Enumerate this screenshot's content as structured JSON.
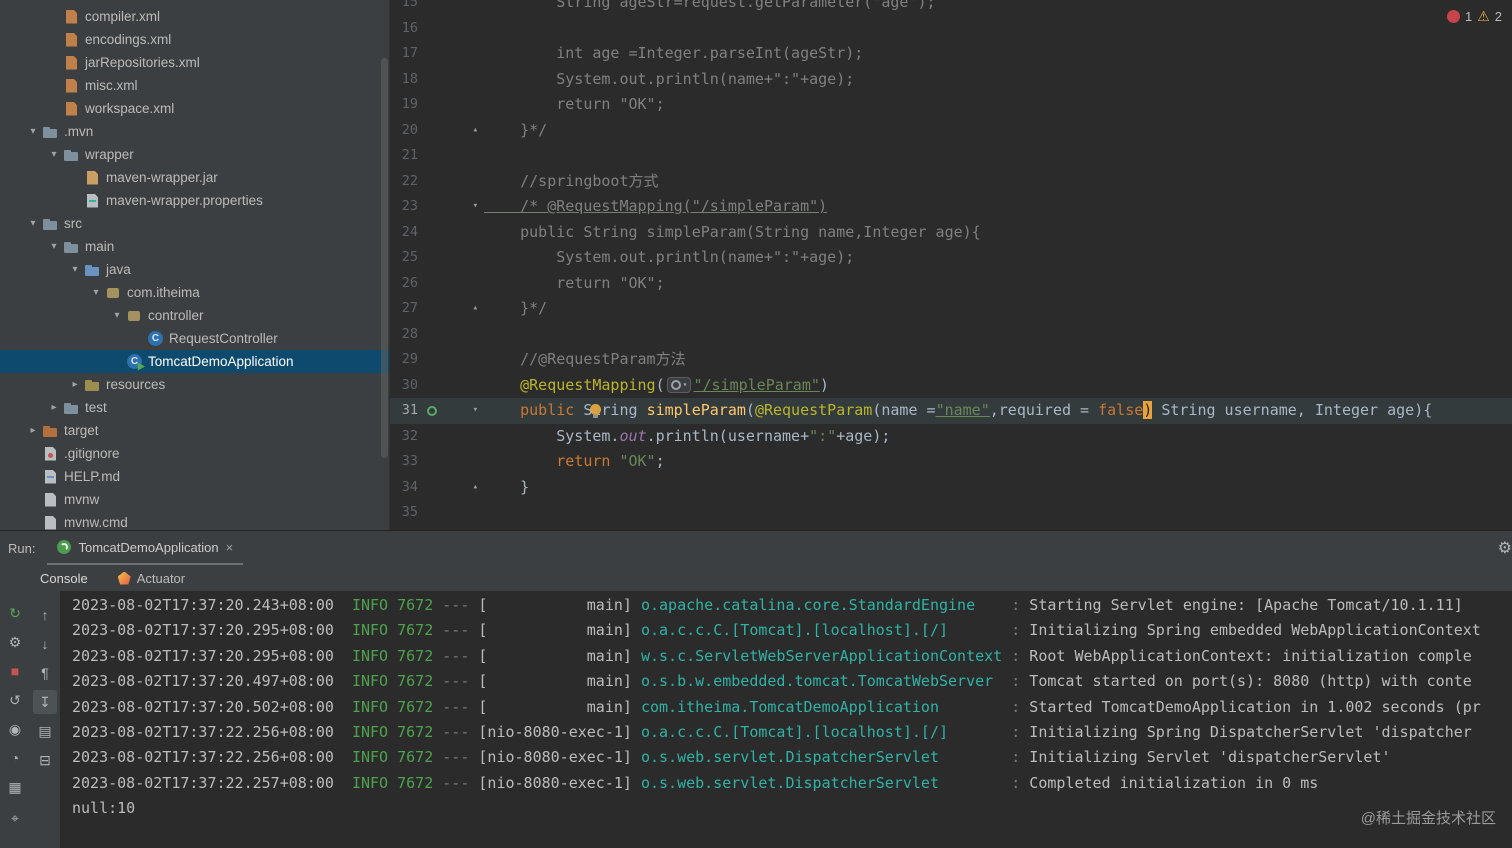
{
  "window": {
    "watermark": "@稀土掘金技术社区"
  },
  "icons": {
    "chevron_expanded": "▾",
    "chevron_collapsed": "▸",
    "fold_down": "▾",
    "fold_up": "▴",
    "warning": "⚠",
    "gear": "⚙"
  },
  "inspections": {
    "errors": "1",
    "warnings": "2"
  },
  "project_tree": {
    "items": [
      {
        "label": "compiler.xml",
        "level": 1,
        "icon": "xml"
      },
      {
        "label": "encodings.xml",
        "level": 1,
        "icon": "xml"
      },
      {
        "label": "jarRepositories.xml",
        "level": 1,
        "icon": "xml"
      },
      {
        "label": "misc.xml",
        "level": 1,
        "icon": "xml"
      },
      {
        "label": "workspace.xml",
        "level": 1,
        "icon": "xml"
      },
      {
        "label": ".mvn",
        "level": 0,
        "icon": "folder",
        "state": "expanded"
      },
      {
        "label": "wrapper",
        "level": 1,
        "icon": "folder",
        "state": "expanded"
      },
      {
        "label": "maven-wrapper.jar",
        "level": 2,
        "icon": "jar"
      },
      {
        "label": "maven-wrapper.properties",
        "level": 2,
        "icon": "props"
      },
      {
        "label": "src",
        "level": 0,
        "icon": "folder",
        "state": "expanded"
      },
      {
        "label": "main",
        "level": 1,
        "icon": "folder",
        "state": "expanded"
      },
      {
        "label": "java",
        "level": 2,
        "icon": "folder-src",
        "state": "expanded"
      },
      {
        "label": "com.itheima",
        "level": 3,
        "icon": "package",
        "state": "expanded"
      },
      {
        "label": "controller",
        "level": 4,
        "icon": "package",
        "state": "expanded"
      },
      {
        "label": "RequestController",
        "level": 5,
        "icon": "class"
      },
      {
        "label": "TomcatDemoApplication",
        "level": 4,
        "icon": "class-run",
        "selected": true
      },
      {
        "label": "resources",
        "level": 2,
        "icon": "folder-res",
        "state": "collapsed"
      },
      {
        "label": "test",
        "level": 1,
        "icon": "folder",
        "state": "collapsed"
      },
      {
        "label": "target",
        "level": 0,
        "icon": "folder-exc",
        "state": "collapsed"
      },
      {
        "label": ".gitignore",
        "level": 0,
        "icon": "git"
      },
      {
        "label": "HELP.md",
        "level": 0,
        "icon": "md"
      },
      {
        "label": "mvnw",
        "level": 0,
        "icon": "filegen"
      },
      {
        "label": "mvnw.cmd",
        "level": 0,
        "icon": "filegen"
      }
    ]
  },
  "editor": {
    "lines": [
      {
        "n": 15,
        "tokens": [
          [
            "c",
            "        String ageStr=request.getParameter(\"age\");"
          ]
        ]
      },
      {
        "n": 16,
        "tokens": []
      },
      {
        "n": 17,
        "tokens": [
          [
            "c",
            "        int age =Integer.parseInt(ageStr);"
          ]
        ]
      },
      {
        "n": 18,
        "tokens": [
          [
            "c",
            "        System.out.println(name+\":\"+age);"
          ]
        ]
      },
      {
        "n": 19,
        "tokens": [
          [
            "c",
            "        return \"OK\";"
          ]
        ]
      },
      {
        "n": 20,
        "fold": "up",
        "tokens": [
          [
            "c",
            "    }*/"
          ]
        ]
      },
      {
        "n": 21,
        "tokens": []
      },
      {
        "n": 22,
        "tokens": [
          [
            "c",
            "    //springboot方式"
          ]
        ]
      },
      {
        "n": 23,
        "fold": "down",
        "tokens": [
          [
            "cu",
            "    /* @RequestMapping(\"/simpleParam\")"
          ]
        ]
      },
      {
        "n": 24,
        "tokens": [
          [
            "c",
            "    public String simpleParam(String name,Integer age){"
          ]
        ]
      },
      {
        "n": 25,
        "tokens": [
          [
            "c",
            "        System.out.println(name+\":\"+age);"
          ]
        ]
      },
      {
        "n": 26,
        "tokens": [
          [
            "c",
            "        return \"OK\";"
          ]
        ]
      },
      {
        "n": 27,
        "fold": "up",
        "tokens": [
          [
            "c",
            "    }*/"
          ]
        ]
      },
      {
        "n": 28,
        "tokens": []
      },
      {
        "n": 29,
        "tokens": [
          [
            "c",
            "    //@RequestParam方法"
          ]
        ]
      },
      {
        "n": 30,
        "tokens": [
          [
            "d",
            "    "
          ],
          [
            "a",
            "@RequestMapping"
          ],
          [
            "d",
            "("
          ],
          [
            "inlay",
            ""
          ],
          [
            "slink",
            "\"/simpleParam\""
          ],
          [
            "d",
            ")"
          ]
        ]
      },
      {
        "n": 31,
        "current": true,
        "bean": true,
        "bulb": true,
        "fold": "down",
        "tokens": [
          [
            "d",
            "    "
          ],
          [
            "k",
            "public"
          ],
          [
            "d",
            " String "
          ],
          [
            "m",
            "simpleParam"
          ],
          [
            "d",
            "("
          ],
          [
            "a",
            "@RequestParam"
          ],
          [
            "d",
            "(name ="
          ],
          [
            "slink",
            "\"name\""
          ],
          [
            "d",
            ",required = "
          ],
          [
            "k",
            "false"
          ],
          [
            "caret",
            ")"
          ],
          [
            "d",
            " String username, Integer age){"
          ]
        ]
      },
      {
        "n": 32,
        "tokens": [
          [
            "d",
            "        System."
          ],
          [
            "f",
            "out"
          ],
          [
            "d",
            ".println(username+"
          ],
          [
            "s",
            "\":\""
          ],
          [
            "d",
            "+age);"
          ]
        ]
      },
      {
        "n": 33,
        "tokens": [
          [
            "d",
            "        "
          ],
          [
            "k",
            "return"
          ],
          [
            "d",
            " "
          ],
          [
            "s",
            "\"OK\""
          ],
          [
            "d",
            ";"
          ]
        ]
      },
      {
        "n": 34,
        "fold": "up",
        "tokens": [
          [
            "d",
            "    }"
          ]
        ]
      },
      {
        "n": 35,
        "tokens": []
      }
    ]
  },
  "run_panel": {
    "run_label": "Run:",
    "tab": {
      "title": "TomcatDemoApplication",
      "close": "×"
    },
    "tabs": [
      {
        "label": "Console",
        "selected": true
      },
      {
        "label": "Actuator"
      }
    ],
    "toolbar_main": [
      {
        "name": "rerun-button",
        "glyph": "↻",
        "color": "#5aa45e"
      },
      {
        "name": "settings-button",
        "glyph": "⚙"
      },
      {
        "name": "stop-button",
        "glyph": "■",
        "color": "#c75450"
      },
      {
        "name": "rerun-failed-button",
        "glyph": "↺"
      },
      {
        "name": "thread-dump-button",
        "glyph": "◉"
      },
      {
        "name": "profiler-button",
        "glyph": "◔"
      },
      {
        "name": "layout-button",
        "glyph": "▦"
      },
      {
        "name": "pin-button",
        "glyph": "⌖",
        "bottom": true
      }
    ],
    "toolbar_console": [
      {
        "name": "prev-occurrence-button",
        "glyph": "↑"
      },
      {
        "name": "next-occurrence-button",
        "glyph": "↓"
      },
      {
        "name": "soft-wrap-button",
        "glyph": "¶"
      },
      {
        "name": "scroll-to-end-button",
        "glyph": "↧",
        "active": true
      },
      {
        "name": "print-button",
        "glyph": "▤"
      },
      {
        "name": "clear-console-button",
        "glyph": "⊟"
      }
    ],
    "console": {
      "lines": [
        {
          "ts": "2023-08-02T17:37:20.243+08:00",
          "level": "INFO",
          "pid": "7672",
          "thread": "main",
          "logger": "o.apache.catalina.core.StandardEngine",
          "msg": "Starting Servlet engine: [Apache Tomcat/10.1.11]"
        },
        {
          "ts": "2023-08-02T17:37:20.295+08:00",
          "level": "INFO",
          "pid": "7672",
          "thread": "main",
          "logger": "o.a.c.c.C.[Tomcat].[localhost].[/]",
          "msg": "Initializing Spring embedded WebApplicationContext"
        },
        {
          "ts": "2023-08-02T17:37:20.295+08:00",
          "level": "INFO",
          "pid": "7672",
          "thread": "main",
          "logger": "w.s.c.ServletWebServerApplicationContext",
          "msg": "Root WebApplicationContext: initialization comple"
        },
        {
          "ts": "2023-08-02T17:37:20.497+08:00",
          "level": "INFO",
          "pid": "7672",
          "thread": "main",
          "logger": "o.s.b.w.embedded.tomcat.TomcatWebServer",
          "msg": "Tomcat started on port(s): 8080 (http) with conte"
        },
        {
          "ts": "2023-08-02T17:37:20.502+08:00",
          "level": "INFO",
          "pid": "7672",
          "thread": "main",
          "logger": "com.itheima.TomcatDemoApplication",
          "msg": "Started TomcatDemoApplication in 1.002 seconds (pr"
        },
        {
          "ts": "2023-08-02T17:37:22.256+08:00",
          "level": "INFO",
          "pid": "7672",
          "thread": "nio-8080-exec-1",
          "logger": "o.a.c.c.C.[Tomcat].[localhost].[/]",
          "msg": "Initializing Spring DispatcherServlet 'dispatcher"
        },
        {
          "ts": "2023-08-02T17:37:22.256+08:00",
          "level": "INFO",
          "pid": "7672",
          "thread": "nio-8080-exec-1",
          "logger": "o.s.web.servlet.DispatcherServlet",
          "msg": "Initializing Servlet 'dispatcherServlet'"
        },
        {
          "ts": "2023-08-02T17:37:22.257+08:00",
          "level": "INFO",
          "pid": "7672",
          "thread": "nio-8080-exec-1",
          "logger": "o.s.web.servlet.DispatcherServlet",
          "msg": "Completed initialization in 0 ms"
        }
      ],
      "stdout": "null:10"
    }
  }
}
